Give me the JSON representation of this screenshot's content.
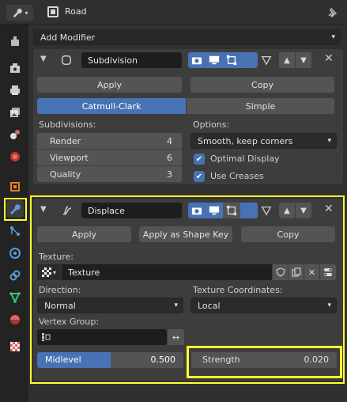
{
  "header": {
    "object_name": "Road",
    "editor_icon": "wrench-editor-icon",
    "pin_icon": "pin-icon"
  },
  "sidebar": {
    "items": [
      {
        "name": "tool-properties",
        "icon": "tool-icon"
      },
      {
        "name": "render-properties",
        "icon": "camera-back-icon"
      },
      {
        "name": "output-properties",
        "icon": "printer-icon"
      },
      {
        "name": "view-layer-properties",
        "icon": "images-icon"
      },
      {
        "name": "scene-properties",
        "icon": "scene-icon"
      },
      {
        "name": "world-properties",
        "icon": "world-icon"
      },
      {
        "name": "object-properties",
        "icon": "object-square-icon"
      },
      {
        "name": "modifier-properties",
        "icon": "wrench-icon",
        "active": true
      },
      {
        "name": "particles-properties",
        "icon": "particles-icon"
      },
      {
        "name": "physics-properties",
        "icon": "physics-icon"
      },
      {
        "name": "constraints-properties",
        "icon": "constraints-icon"
      },
      {
        "name": "data-properties",
        "icon": "vertex-data-icon"
      },
      {
        "name": "material-properties",
        "icon": "material-sphere-icon"
      },
      {
        "name": "texture-properties",
        "icon": "checker-icon"
      }
    ]
  },
  "add_modifier": {
    "label": "Add Modifier"
  },
  "subdivision": {
    "name": "Subdivision",
    "apply_label": "Apply",
    "copy_label": "Copy",
    "tabs": {
      "catmull": "Catmull-Clark",
      "simple": "Simple"
    },
    "subdivisions_label": "Subdivisions:",
    "render_label": "Render",
    "render_value": "4",
    "viewport_label": "Viewport",
    "viewport_value": "6",
    "quality_label": "Quality",
    "quality_value": "3",
    "options_label": "Options:",
    "options_value": "Smooth, keep corners",
    "optimal_display": "Optimal Display",
    "use_creases": "Use Creases"
  },
  "displace": {
    "name": "Displace",
    "apply_label": "Apply",
    "apply_shape_key_label": "Apply as Shape Key",
    "copy_label": "Copy",
    "texture_label": "Texture:",
    "texture_value": "Texture",
    "direction_label": "Direction:",
    "direction_value": "Normal",
    "texcoords_label": "Texture Coordinates:",
    "texcoords_value": "Local",
    "vertex_group_label": "Vertex Group:",
    "midlevel_label": "Midlevel",
    "midlevel_value": "0.500",
    "midlevel_fraction": 0.5,
    "strength_label": "Strength",
    "strength_value": "0.020"
  },
  "colors": {
    "accent_blue": "#4772b3",
    "highlight_yellow": "#ffff33",
    "panel": "#3d3d3d",
    "background": "#303030"
  }
}
